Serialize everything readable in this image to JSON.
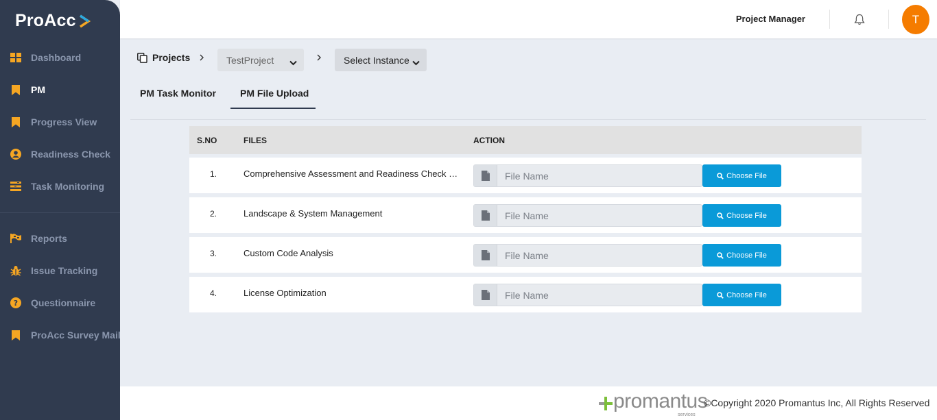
{
  "app": {
    "name": "ProAcc"
  },
  "sidebar": {
    "items": [
      {
        "label": "Dashboard",
        "icon": "dashboard-icon",
        "active": false
      },
      {
        "label": "PM",
        "icon": "bookmark-icon",
        "active": true
      },
      {
        "label": "Progress View",
        "icon": "bookmark-icon",
        "active": false
      },
      {
        "label": "Readiness Check",
        "icon": "user-circle-icon",
        "active": false
      },
      {
        "label": "Task Monitoring",
        "icon": "tasks-icon",
        "active": false
      },
      {
        "label": "Reports",
        "icon": "flag-icon",
        "active": false
      },
      {
        "label": "Issue Tracking",
        "icon": "bug-icon",
        "active": false
      },
      {
        "label": "Questionnaire",
        "icon": "question-circle-icon",
        "active": false
      },
      {
        "label": "ProAcc Survey Mail",
        "icon": "bookmark-icon",
        "active": false
      }
    ],
    "accent_color": "#f5a623"
  },
  "header": {
    "role": "Project Manager",
    "avatar_initial": "T",
    "avatar_color": "#f57c00"
  },
  "breadcrumb": {
    "projects_label": "Projects",
    "project_select_value": "TestProject",
    "instance_select_value": "Select Instance"
  },
  "tabs": [
    {
      "label": "PM Task Monitor",
      "active": false
    },
    {
      "label": "PM File Upload",
      "active": true
    }
  ],
  "table": {
    "headers": {
      "sno": "S.NO",
      "files": "FILES",
      "action": "ACTION"
    },
    "rows": [
      {
        "sno": "1.",
        "file": "Comprehensive Assessment and Readiness Check Re...",
        "placeholder": "File Name",
        "button": "Choose File"
      },
      {
        "sno": "2.",
        "file": "Landscape & System Management",
        "placeholder": "File Name",
        "button": "Choose File"
      },
      {
        "sno": "3.",
        "file": "Custom Code Analysis",
        "placeholder": "File Name",
        "button": "Choose File"
      },
      {
        "sno": "4.",
        "file": "License Optimization",
        "placeholder": "File Name",
        "button": "Choose File"
      }
    ],
    "button_color": "#0a9ad8"
  },
  "footer": {
    "brand": "promantus",
    "brand_sub": "services",
    "copyright": "©Copyright 2020 Promantus Inc, All Rights Reserved"
  }
}
